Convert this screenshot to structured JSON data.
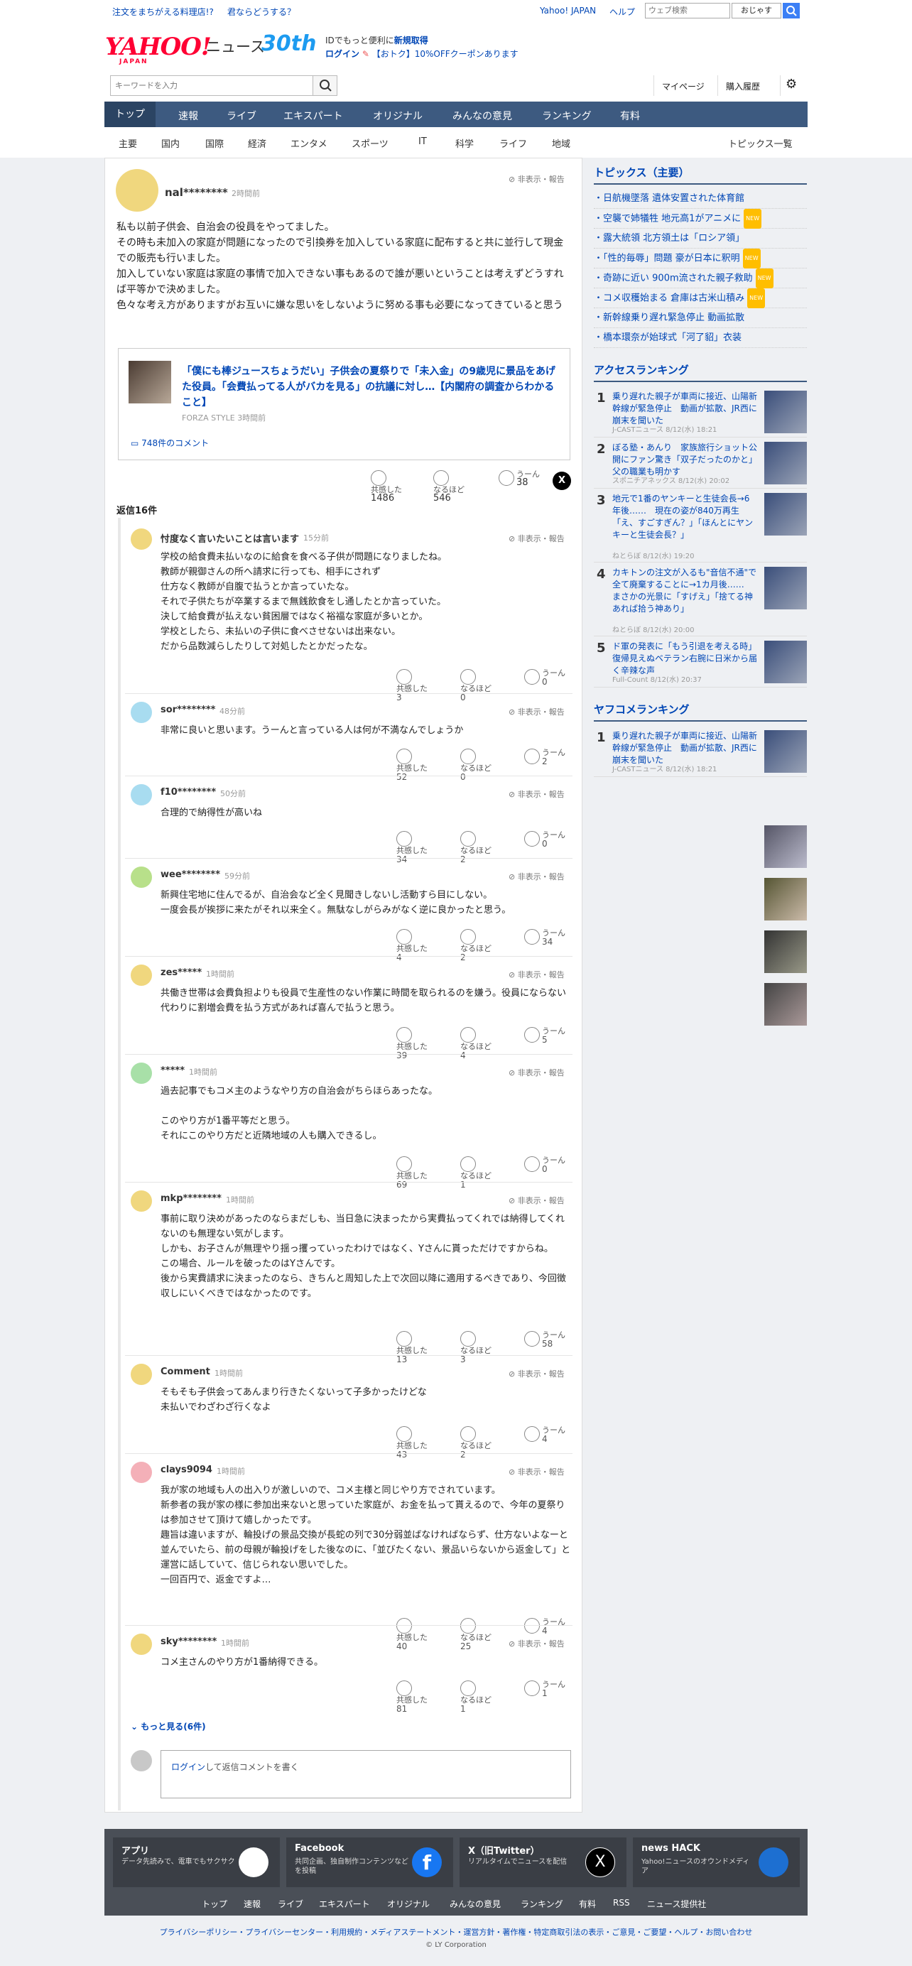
{
  "top": {
    "promo1": "注文をまちがえる料理店!?",
    "promo2": "君ならどうする？",
    "yj": "Yahoo! JAPAN",
    "help": "ヘルプ",
    "search_placeholder": "ウェブ検索",
    "search_btn": "おじゃす"
  },
  "header": {
    "logo": "YAHOO!",
    "logo_sub": "JAPAN",
    "news": "ニュース",
    "anniv": "30th",
    "promo_l1": "IDでもっと便利に",
    "promo_l1b": "新規取得",
    "promo_l2a": "ログイン",
    "promo_l2b": "【おトク】10%OFFクーポンあります",
    "kw_placeholder": "キーワードを入力",
    "mypage": "マイページ",
    "history": "購入履歴"
  },
  "nav": [
    "トップ",
    "速報",
    "ライブ",
    "エキスパート",
    "オリジナル",
    "みんなの意見",
    "ランキング",
    "有料"
  ],
  "subnav": [
    "主要",
    "国内",
    "国際",
    "経済",
    "エンタメ",
    "スポーツ",
    "IT",
    "科学",
    "ライフ",
    "地域"
  ],
  "topics_list": "トピックス一覧",
  "main_comment": {
    "user": "nal********",
    "time": "2時間前",
    "report": "非表示・報告",
    "text": "私も以前子供会、自治会の役員をやってました。\nその時も未加入の家庭が問題になったので引換券を加入している家庭に配布すると共に並行して現金での販売も行いました。\n加入していない家庭は家庭の事情で加入できない事もあるので誰が悪いということは考えずどうすれば平等かで決めました。\n色々な考え方がありますがお互いに嫌な思いをしないように努める事も必要になってきていると思う"
  },
  "article": {
    "title": "「僕にも棒ジュースちょうだい」子供会の夏祭りで「未入金」の9歳児に景品をあげた役員。「会費払ってる人がバカを見る」の抗議に対し…【内閣府の調査からわかること】",
    "source": "FORZA STYLE",
    "time": "3時間前",
    "comments": "748件のコメント"
  },
  "main_reacts": {
    "l1": "共感した",
    "v1": "1486",
    "l2": "なるほど",
    "v2": "546",
    "l3": "うーん",
    "v3": "38"
  },
  "replies_label": "返信16件",
  "replies": [
    {
      "user": "忖度なく言いたいことは言います",
      "time": "15分前",
      "text": "学校の給食費未払いなのに給食を食べる子供が問題になりましたね。\n教師が親御さんの所へ請求に行っても、相手にされず\n仕方なく教師が自腹で払うとか言っていたな。\nそれで子供たちが卒業するまで無銭飲食をし通したとか言っていた。\n決して給食費が払えない貧困層ではなく裕福な家庭が多いとか。\n学校としたら、未払いの子供に食べさせないは出来ない。\nだから品数減らしたりして対処したとかだったな。",
      "a": "3",
      "b": "0",
      "c": "0"
    },
    {
      "user": "sor********",
      "time": "48分前",
      "text": "非常に良いと思います。うーんと言っている人は何が不満なんでしょうか",
      "a": "52",
      "b": "0",
      "c": "2"
    },
    {
      "user": "f10********",
      "time": "50分前",
      "text": "合理的で納得性が高いね",
      "a": "34",
      "b": "2",
      "c": "0"
    },
    {
      "user": "wee********",
      "time": "59分前",
      "text": "新興住宅地に住んでるが、自治会など全く見聞きしないし活動すら目にしない。\n一度会長が挨拶に来たがそれ以来全く。無駄なしがらみがなく逆に良かったと思う。",
      "a": "4",
      "b": "2",
      "c": "34"
    },
    {
      "user": "zes*****",
      "time": "1時間前",
      "text": "共働き世帯は会費負担よりも役員で生産性のない作業に時間を取られるのを嫌う。役員にならない代わりに割増会費を払う方式があれば喜んで払うと思う。",
      "a": "39",
      "b": "4",
      "c": "5"
    },
    {
      "user": "*****",
      "time": "1時間前",
      "text": "過去記事でもコメ主のようなやり方の自治会がちらほらあったな。\n\nこのやり方が1番平等だと思う。\nそれにこのやり方だと近隣地域の人も購入できるし。",
      "a": "69",
      "b": "1",
      "c": "0"
    },
    {
      "user": "mkp********",
      "time": "1時間前",
      "text": "事前に取り決めがあったのならまだしも、当日急に決まったから実費払ってくれでは納得してくれないのも無理ない気がします。\nしかも、お子さんが無理やり揺っ攫っていったわけではなく、Yさんに貰っただけですからね。\nこの場合、ルールを破ったのはYさんです。\n後から実費請求に決まったのなら、きちんと周知した上で次回以降に適用するべきであり、今回徴収しにいくべきではなかったのです。",
      "a": "13",
      "b": "3",
      "c": "58"
    },
    {
      "user": "Comment",
      "time": "1時間前",
      "text": "そもそも子供会ってあんまり行きたくないって子多かったけどな\n未払いでわざわざ行くなよ",
      "a": "43",
      "b": "2",
      "c": "4"
    },
    {
      "user": "clays9094",
      "time": "1時間前",
      "text": "我が家の地域も人の出入りが激しいので、コメ主様と同じやり方でされています。\n新参者の我が家の様に参加出来ないと思っていた家庭が、お金を払って貰えるので、今年の夏祭りは参加させて頂けて嬉しかったです。\n趣旨は違いますが、輪投げの景品交換が長蛇の列で30分弱並ばなければならず、仕方ないよなーと並んでいたら、前の母親が輪投げをした後なのに、「並びたくない、景品いらないから返金して」と運営に話していて、信じられない思いでした。\n一回百円で、返金ですよ…",
      "a": "40",
      "b": "25",
      "c": "4"
    },
    {
      "user": "sky********",
      "time": "1時間前",
      "text": "コメ主さんのやり方が1番納得できる。",
      "a": "81",
      "b": "1",
      "c": "1"
    }
  ],
  "more": "もっと見る(6件)",
  "reply_login": "ログイン",
  "reply_placeholder": "して返信コメントを書く",
  "topics": {
    "heading": "トピックス（主要）",
    "items": [
      "日航機墜落 遺体安置された体育館",
      "空襲で姉犠牲 地元高1がアニメに",
      "露大統領 北方領土は「ロシア領」",
      "「性的毎辱」問題 豪が日本に釈明",
      "奇跡に近い 900m流された親子救助",
      "コメ収穫始まる 倉庫は古米山積み",
      "新幹線乗り遅れ緊急停止 動画拡散",
      "橋本環奈が始球式「河了貂」衣装"
    ]
  },
  "access": {
    "heading": "アクセスランキング",
    "items": [
      {
        "n": "1",
        "t": "乗り遅れた親子が車両に接近、山陽新幹線が緊急停止　動画が拡散、JR西に崩末を聞いた",
        "m": "J-CASTニュース 8/12(水) 18:21"
      },
      {
        "n": "2",
        "t": "ぼる塾・あんり　家族旅行ショット公開にファン驚き「双子だったのかと」父の職業も明かす",
        "m": "スポニチアネックス 8/12(水) 20:02"
      },
      {
        "n": "3",
        "t": "地元で1番のヤンキーと生徒会長→6年後……　現在の姿が840万再生「え、すごすぎん？」「ほんとにヤンキーと生徒会長？」",
        "m": "ねとらぼ 8/12(水) 19:20"
      },
      {
        "n": "4",
        "t": "カキトンの注文が入るも\"音信不通\"で全て廃棄することに→1カ月後……　まさかの光景に「すげえ」「捨てる神あれば拾う神あり」",
        "m": "ねとらぼ 8/12(水) 20:00"
      },
      {
        "n": "5",
        "t": "ド軍の発表に「もう引退を考える時」 復帰見えぬベテラン右腕に日米から届く辛辣な声",
        "m": "Full-Count 8/12(水) 20:37"
      }
    ]
  },
  "yafuko": {
    "heading": "ヤフコメランキング",
    "items": [
      {
        "n": "1",
        "t": "乗り遅れた親子が車両に接近、山陽新幹線が緊急停止　動画が拡散、JR西に崩末を聞いた",
        "m": "J-CASTニュース 8/12(水) 18:21"
      }
    ]
  },
  "footer": {
    "cards": [
      {
        "title": "アプリ",
        "desc": "データ先読みで、電車でもサクサク"
      },
      {
        "title": "Facebook",
        "desc": "共同企画、独自制作コンテンツなどを投稿"
      },
      {
        "title": "X（旧Twitter）",
        "desc": "リアルタイムでニュースを配信"
      },
      {
        "title": "news HACK",
        "desc": "Yahoo!ニュースのオウンドメディア"
      }
    ],
    "links": [
      "トップ",
      "速報",
      "ライブ",
      "エキスパート",
      "オリジナル",
      "みんなの意見",
      "ランキング",
      "有料",
      "RSS",
      "ニュース提供社"
    ],
    "bottom": "プライバシーポリシー・プライバシーセンター・利用規約・メディアステートメント・運営方針・著作権・特定商取引法の表示・ご意見・ご要望・ヘルプ・お問い合わせ",
    "copy": "© LY Corporation"
  },
  "colors": {
    "nav": "#3d5a80",
    "accent": "#0046b5",
    "logo": "#ff0033"
  }
}
